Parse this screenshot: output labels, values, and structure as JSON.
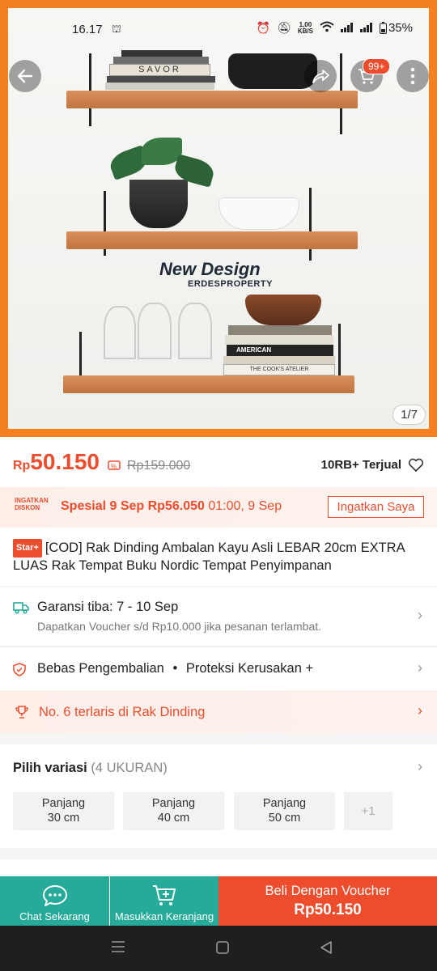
{
  "status_bar": {
    "time": "16.17",
    "network_speed": "1,00",
    "network_unit": "KB/S",
    "battery": "35%"
  },
  "hero": {
    "cart_badge": "99+",
    "image_counter": "1/7",
    "overlay_title": "New Design",
    "overlay_brand": "ERDESPROPERTY",
    "book_labels": [
      "SAVOR",
      "AMERICAN",
      "THE COOK'S ATELIER"
    ]
  },
  "price": {
    "currency": "Rp",
    "current": "50.150",
    "original": "Rp159.000",
    "sold": "10RB+ Terjual"
  },
  "reminder": {
    "label_line1": "INGATKAN",
    "label_line2": "DISKON",
    "special": "Spesial 9 Sep",
    "special_price": "Rp56.050",
    "time": "01:00, 9 Sep",
    "button": "Ingatkan Saya"
  },
  "product": {
    "tag": "Star+",
    "title": "[COD] Rak Dinding Ambalan Kayu Asli LEBAR 20cm EXTRA LUAS Rak Tempat Buku Nordic Tempat Penyimpanan"
  },
  "shipping": {
    "title": "Garansi tiba: 7 - 10 Sep",
    "subtitle": "Dapatkan Voucher s/d Rp10.000 jika pesanan terlambat."
  },
  "returns": {
    "text_1": "Bebas Pengembalian",
    "separator": "•",
    "text_2": "Proteksi Kerusakan +"
  },
  "ranking": {
    "text": "No. 6 terlaris di Rak Dinding"
  },
  "variation": {
    "title": "Pilih variasi",
    "count": "(4 UKURAN)",
    "options": [
      {
        "line1": "Panjang",
        "line2": "30 cm"
      },
      {
        "line1": "Panjang",
        "line2": "40 cm"
      },
      {
        "line1": "Panjang",
        "line2": "50 cm"
      }
    ],
    "more": "+1"
  },
  "bottom_bar": {
    "chat": "Chat Sekarang",
    "cart": "Masukkan Keranjang",
    "buy_label": "Beli Dengan Voucher",
    "buy_price": "Rp50.150"
  },
  "colors": {
    "brand": "#ee4d2d",
    "teal": "#26aa99",
    "hero_border": "#f5801f"
  }
}
